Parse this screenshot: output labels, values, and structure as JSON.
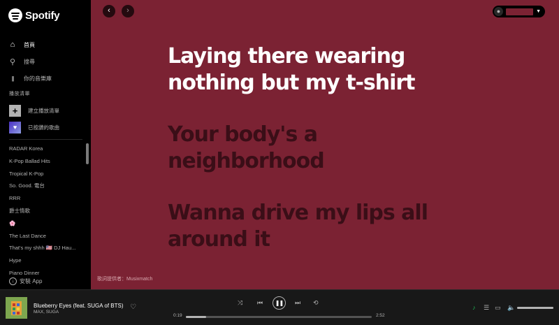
{
  "app": {
    "name": "Spotify"
  },
  "sidebar": {
    "nav": [
      {
        "label": "首頁",
        "icon": "home-icon",
        "glyph": "⌂",
        "active": true
      },
      {
        "label": "搜尋",
        "icon": "search-icon",
        "glyph": "⚲",
        "active": false
      },
      {
        "label": "你的音樂庫",
        "icon": "library-icon",
        "glyph": "|||",
        "active": false
      }
    ],
    "section_title": "播放清單",
    "create_playlist": "建立播放清單",
    "liked_songs": "已按讚的歌曲",
    "playlists": [
      "RADAR Korea",
      "K-Pop Ballad Hits",
      "Tropical K-Pop",
      "So. Good. 電台",
      "RRR",
      "爵士情歌",
      "🌸",
      "The Last Dance",
      "That's my shhh 🇺🇸 DJ Hau...",
      "Hype",
      "Piano Dinner"
    ],
    "install_app": "安裝 App"
  },
  "header": {
    "back_glyph": "‹",
    "forward_glyph": "›"
  },
  "lyrics": {
    "lines": [
      {
        "text": "Laying there wearing nothing but my t-shirt",
        "state": "current"
      },
      {
        "text": "Your body's a neighborhood",
        "state": "upcoming"
      },
      {
        "text": "Wanna drive my lips all around it",
        "state": "upcoming"
      }
    ],
    "provider": "歌詞提供者：Musixmatch"
  },
  "now_playing": {
    "title": "Blueberry Eyes (feat. SUGA of BTS)",
    "artist": "MAX, SUGA",
    "elapsed": "0:19",
    "total": "2:52",
    "progress_fraction": 0.11,
    "volume_fraction": 1.0
  },
  "colors": {
    "lyrics_background": "#7b2233",
    "lyric_current": "#ffffff",
    "lyric_upcoming": "#3a0e17",
    "accent": "#1db954"
  }
}
